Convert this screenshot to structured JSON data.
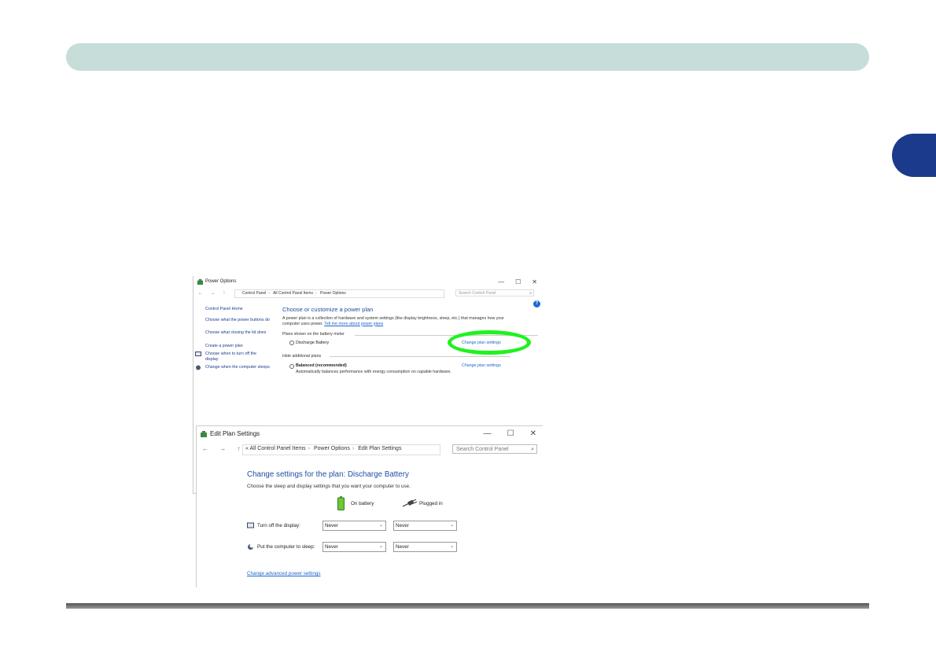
{
  "power_options": {
    "title": "Power Options",
    "controls": {
      "minimize": "—",
      "maximize": "☐",
      "close": "✕"
    },
    "nav": "← → ↑",
    "breadcrumb": [
      "Control Panel",
      "All Control Panel Items",
      "Power Options"
    ],
    "search_placeholder": "Search Control Panel",
    "left_pane": {
      "home": "Control Panel Home",
      "items": [
        "Choose what the power buttons do",
        "Choose what closing the lid does",
        "Create a power plan",
        "Choose when to turn off the display",
        "Change when the computer sleeps"
      ]
    },
    "heading": "Choose or customize a power plan",
    "description": "A power plan is a collection of hardware and system settings (like display brightness, sleep, etc.) that manages how your computer uses power.",
    "learn_more_link": "Tell me more about power plans",
    "battery_meter_section": "Plans shown on the battery meter",
    "plan_discharge": "Discharge Battery",
    "change_plan_link_1": "Change plan settings",
    "hide_plans": "Hide additional plans",
    "plan_balanced": "Balanced (recommended)",
    "balanced_desc": "Automatically balances performance with energy consumption on capable hardware.",
    "change_plan_link_2": "Change plan settings",
    "help_badge": "?"
  },
  "edit_plan": {
    "title": "Edit Plan Settings",
    "controls": {
      "minimize": "—",
      "maximize": "☐",
      "close": "✕"
    },
    "nav": "← → ↑",
    "breadcrumb_prefix": "«",
    "breadcrumb": [
      "All Control Panel Items",
      "Power Options",
      "Edit Plan Settings"
    ],
    "search_placeholder": "Search Control Panel",
    "heading": "Change settings for the plan: Discharge Battery",
    "subheading": "Choose the sleep and display settings that you want your computer to use.",
    "col_battery": "On battery",
    "col_plugged": "Plugged in",
    "rows": [
      {
        "label": "Turn off the display:",
        "battery": "Never",
        "plugged": "Never"
      },
      {
        "label": "Put the computer to sleep:",
        "battery": "Never",
        "plugged": "Never"
      }
    ],
    "advanced_link": "Change advanced power settings"
  },
  "colors": {
    "header_bar": "#c6ddd9",
    "side_tab": "#1b3a8c",
    "highlight_ring": "#1ff21f",
    "link": "#1e66c8",
    "heading": "#1e4ea3"
  }
}
